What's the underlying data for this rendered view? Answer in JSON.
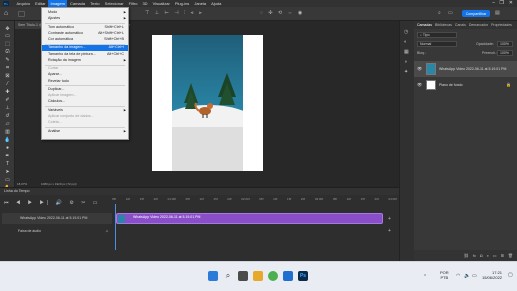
{
  "menubar": {
    "logo": "Ps",
    "items": [
      "Arquivo",
      "Editar",
      "Imagem",
      "Camada",
      "Texto",
      "Selecionar",
      "Filtro",
      "3D",
      "Visualizar",
      "Plug-ins",
      "Janela",
      "Ajuda"
    ],
    "active_index": 2
  },
  "optbar": {
    "share_label": "Compartilhar"
  },
  "doc_tab": {
    "label": "Sem Título-1 @ WhatsApp Video 2022-06-11 at 5.19.01 PM, RGB/8",
    "close": "×"
  },
  "image_menu": {
    "items": [
      {
        "label": "Modo",
        "shortcut": "",
        "submenu": true,
        "disabled": false
      },
      {
        "label": "Ajustes",
        "shortcut": "",
        "submenu": true,
        "disabled": false
      },
      {
        "label": "Tom automático",
        "shortcut": "Shift+Ctrl+L",
        "submenu": false,
        "disabled": false
      },
      {
        "label": "Contraste automático",
        "shortcut": "Alt+Shift+Ctrl+L",
        "submenu": false,
        "disabled": false
      },
      {
        "label": "Cor automática",
        "shortcut": "Shift+Ctrl+B",
        "submenu": false,
        "disabled": false
      },
      {
        "label": "Tamanho da imagem...",
        "shortcut": "Alt+Ctrl+I",
        "submenu": false,
        "disabled": false,
        "highlight": true
      },
      {
        "label": "Tamanho da tela de pintura...",
        "shortcut": "Alt+Ctrl+C",
        "submenu": false,
        "disabled": false
      },
      {
        "label": "Rotação da imagem",
        "shortcut": "",
        "submenu": true,
        "disabled": false
      },
      {
        "label": "Cortar",
        "shortcut": "",
        "submenu": false,
        "disabled": true
      },
      {
        "label": "Aparar...",
        "shortcut": "",
        "submenu": false,
        "disabled": false
      },
      {
        "label": "Revelar tudo",
        "shortcut": "",
        "submenu": false,
        "disabled": false
      },
      {
        "label": "Duplicar...",
        "shortcut": "",
        "submenu": false,
        "disabled": false
      },
      {
        "label": "Aplicar imagem...",
        "shortcut": "",
        "submenu": false,
        "disabled": true
      },
      {
        "label": "Cálculos...",
        "shortcut": "",
        "submenu": false,
        "disabled": false
      },
      {
        "label": "Variáveis",
        "shortcut": "",
        "submenu": true,
        "disabled": false
      },
      {
        "label": "Aplicar conjunto de dados...",
        "shortcut": "",
        "submenu": false,
        "disabled": true
      },
      {
        "label": "Coleta...",
        "shortcut": "",
        "submenu": false,
        "disabled": true
      },
      {
        "label": "Análise",
        "shortcut": "",
        "submenu": true,
        "disabled": false
      }
    ]
  },
  "status": {
    "zoom": "18,07%",
    "size": "1080 px x 1920 px (72 ppi)"
  },
  "panels": {
    "tabs": [
      "Camadas",
      "Bibliotecas",
      "Canais",
      "Demarcador",
      "Propriedades"
    ],
    "search_kind": "Tipo",
    "blend_mode": "Normal",
    "opacity_label": "Opacidade:",
    "opacity_value": "100%",
    "lock_label": "Bloq.:",
    "fill_label": "Preench.:",
    "fill_value": "100%",
    "layers": [
      {
        "name": "WhatsApp Video 2022-06-11 at 5.19.01 PM"
      },
      {
        "name": "Plano de fundo"
      }
    ]
  },
  "timeline": {
    "title": "Linha do Tempo",
    "track_label": "WhatsApp Video 2022-06-11 at 5.19.01 PM",
    "clip_label": "WhatsApp Video 2022-06-11 at 5.19.01 PM",
    "audio_label": "Faixa de áudio",
    "time": "0:00:00:00",
    "fps": "(30,00 fps)",
    "ruler": [
      "05f",
      "10f",
      "15f",
      "20f",
      "01:00f",
      "05f",
      "10f",
      "15f",
      "20f",
      "02:00f",
      "05f",
      "10f",
      "15f",
      "20f",
      "03:00f",
      "05f",
      "10f",
      "15f",
      "20f",
      "04:00f"
    ]
  },
  "taskbar": {
    "lang1": "POR",
    "lang2": "PTB",
    "clock": "17:21",
    "date": "15/06/2022"
  },
  "colors": {
    "accent": "#1473e6",
    "clip": "#8a4fc8",
    "menu_bg": "#f0f0f0"
  }
}
